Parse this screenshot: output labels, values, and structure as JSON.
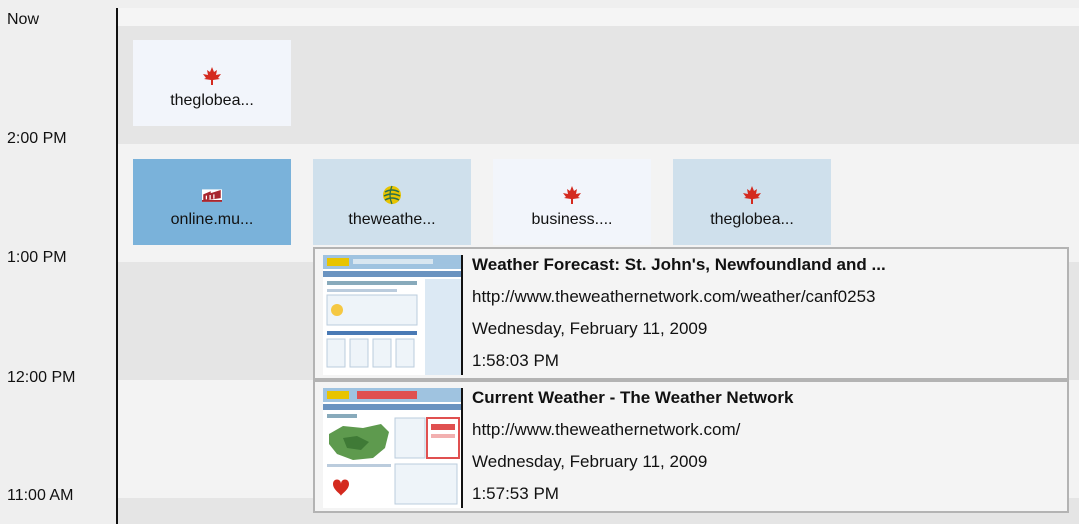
{
  "timeline": {
    "labels": [
      "Now",
      "2:00 PM",
      "1:00 PM",
      "12:00 PM",
      "11:00 AM"
    ]
  },
  "tiles": [
    {
      "label": "theglobea...",
      "icon": "maple-leaf-icon",
      "state": "light"
    },
    {
      "label": "online.mu...",
      "icon": "red-building-icon",
      "state": "selected"
    },
    {
      "label": "theweathe...",
      "icon": "yellow-globe-icon",
      "state": "pale"
    },
    {
      "label": "business....",
      "icon": "maple-leaf-icon",
      "state": "light"
    },
    {
      "label": "theglobea...",
      "icon": "maple-leaf-icon",
      "state": "pale"
    }
  ],
  "popups": [
    {
      "title": "Weather Forecast: St. John's, Newfoundland and ...",
      "url": "http://www.theweathernetwork.com/weather/canf0253",
      "date": "Wednesday, February 11, 2009",
      "time": "1:58:03 PM"
    },
    {
      "title": "Current Weather - The Weather Network",
      "url": "http://www.theweathernetwork.com/",
      "date": "Wednesday, February 11, 2009",
      "time": "1:57:53 PM"
    }
  ],
  "colors": {
    "selected_tile": "#7ab2da",
    "pale_tile": "#cfe0ec",
    "light_tile": "#f2f5fb",
    "maple_leaf": "#d42a1f"
  }
}
